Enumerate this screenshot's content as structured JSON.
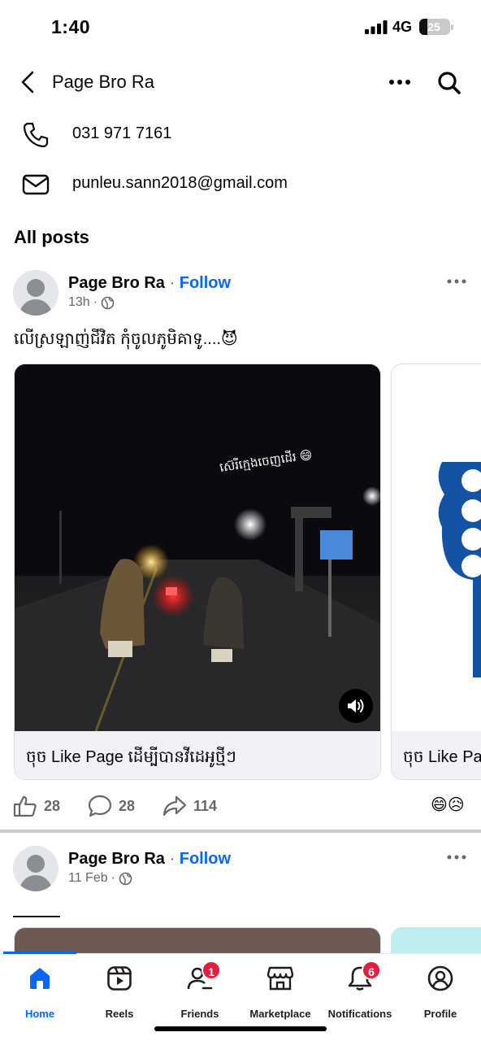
{
  "status": {
    "time": "1:40",
    "network": "4G",
    "battery": "25",
    "battery_level": 0.25
  },
  "header": {
    "title": "Page Bro Ra"
  },
  "contact": {
    "phone": "031 971 7161",
    "email": "punleu.sann2018@gmail.com"
  },
  "section_title": "All posts",
  "posts": [
    {
      "author": "Page Bro Ra",
      "separator": "·",
      "follow": "Follow",
      "time": "13h",
      "meta_dot": "·",
      "caption": "លើស្រឡាញ់ជីវិត កុំចូលភូមិគាទូ....😈",
      "cards": [
        {
          "overlay_text": "ស៊េរីក្មេងចេញដើរ 😄",
          "footer": "ចុច Like Page ដើម្បីបានវីដេអូថ្មីៗ"
        },
        {
          "footer": "ចុច Like Pa"
        }
      ],
      "likes": "28",
      "comments": "28",
      "shares": "114",
      "reactions": "😄😥"
    },
    {
      "author": "Page Bro Ra",
      "separator": "·",
      "follow": "Follow",
      "time": "11 Feb",
      "meta_dot": "·"
    }
  ],
  "nav": {
    "items": [
      {
        "label": "Home",
        "icon": "home-icon",
        "active": true
      },
      {
        "label": "Reels",
        "icon": "reels-icon"
      },
      {
        "label": "Friends",
        "icon": "friends-icon",
        "badge": "1"
      },
      {
        "label": "Marketplace",
        "icon": "marketplace-icon"
      },
      {
        "label": "Notifications",
        "icon": "bell-icon",
        "badge": "6"
      },
      {
        "label": "Profile",
        "icon": "profile-icon"
      }
    ]
  },
  "colors": {
    "accent": "#0866ff",
    "badge": "#e41e3f",
    "muted": "#65676b"
  }
}
